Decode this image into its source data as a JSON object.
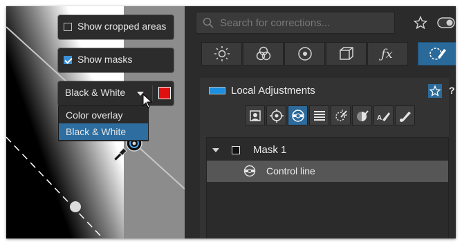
{
  "canvas_overlay": {
    "show_cropped_label": "Show cropped areas",
    "show_cropped_checked": false,
    "show_masks_label": "Show masks",
    "show_masks_checked": true,
    "mode_dropdown": {
      "selected": "Black & White",
      "options": [
        "Color overlay",
        "Black & White"
      ],
      "color_swatch": "#e01010"
    }
  },
  "search": {
    "placeholder": "Search for corrections..."
  },
  "toolbar": {
    "icons": [
      "brightness-icon",
      "color-wheel-icon",
      "detail-icon",
      "geometry-icon",
      "fx-icon",
      "local-adjustments-icon"
    ],
    "active_index": 5
  },
  "local_adjustments": {
    "title": "Local Adjustments",
    "help": "?",
    "tool_icons": [
      "u-point-icon",
      "control-point-icon",
      "control-line-icon",
      "graduated-filter-icon",
      "auto-mask-icon",
      "luminosity-mask-icon",
      "auto-brush-icon",
      "brush-icon"
    ],
    "active_tool_index": 2,
    "mask_tree": [
      {
        "label": "Mask 1",
        "expanded": true,
        "level": 0
      },
      {
        "label": "Control line",
        "level": 1,
        "selected": true
      }
    ]
  },
  "colors": {
    "accent": "#2c6b9b",
    "panel": "#2b2b2b",
    "selection": "#565656"
  }
}
